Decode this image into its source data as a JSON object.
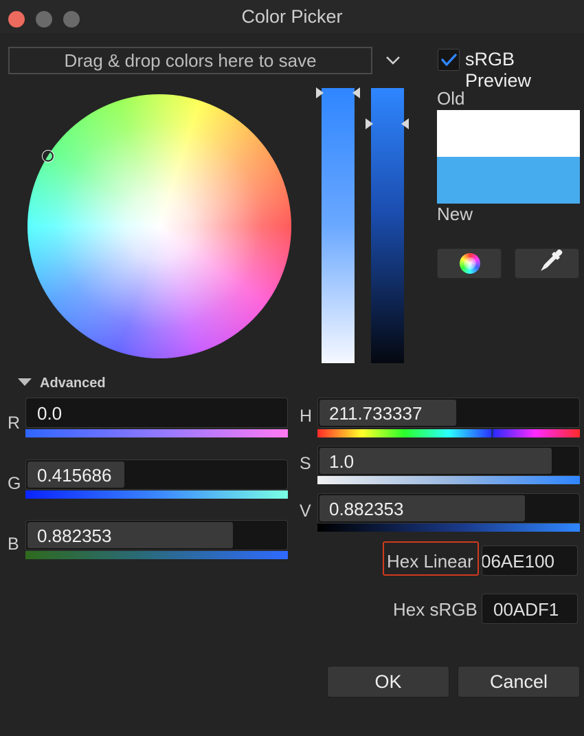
{
  "window": {
    "title": "Color Picker"
  },
  "toolbar": {
    "dropzone_text": "Drag & drop colors here to save",
    "srgb_preview_label": "sRGB Preview",
    "srgb_preview_checked": true
  },
  "preview": {
    "old_label": "Old",
    "new_label": "New",
    "old_color": "#FFFFFF",
    "new_color": "#47ACEE"
  },
  "advanced": {
    "label": "Advanced",
    "r": {
      "label": "R",
      "value": "0.0",
      "level": 0.0
    },
    "g": {
      "label": "G",
      "value": "0.415686",
      "level": 0.415686
    },
    "b": {
      "label": "B",
      "value": "0.882353",
      "level": 0.882353
    },
    "h": {
      "label": "H",
      "value": "211.733337",
      "level": 0.588
    },
    "s": {
      "label": "S",
      "value": "1.0",
      "level": 1.0
    },
    "v": {
      "label": "V",
      "value": "0.882353",
      "level": 0.882353
    },
    "hex_linear": {
      "label": "Hex Linear",
      "value": "06AE100"
    },
    "hex_srgb": {
      "label": "Hex sRGB",
      "value": "00ADF1"
    }
  },
  "buttons": {
    "ok": "OK",
    "cancel": "Cancel"
  },
  "icons": {
    "close": "close-icon",
    "minimize": "minimize-icon",
    "maximize": "maximize-icon",
    "dropdown": "chevron-down-icon",
    "check": "check-icon",
    "color_wheel": "color-wheel-icon",
    "eyedropper": "eyedropper-icon",
    "advanced_toggle": "triangle-down-icon"
  },
  "colors": {
    "accent": "#2F86FF",
    "highlight_border": "#D03A1E",
    "background": "#242424"
  }
}
